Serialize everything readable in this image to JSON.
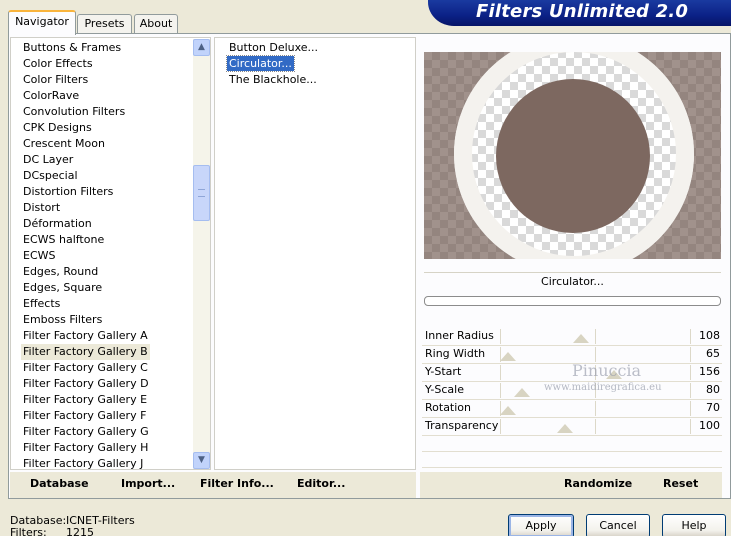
{
  "tabs": [
    {
      "label": "Navigator"
    },
    {
      "label": "Presets"
    },
    {
      "label": "About"
    }
  ],
  "banner": {
    "title": "Filters Unlimited 2.0"
  },
  "categories": [
    "Buttons & Frames",
    "Color Effects",
    "Color Filters",
    "ColorRave",
    "Convolution Filters",
    "CPK Designs",
    "Crescent Moon",
    "DC Layer",
    "DCspecial",
    "Distortion Filters",
    "Distort",
    "Déformation",
    "ECWS halftone",
    "ECWS",
    "Edges, Round",
    "Edges, Square",
    "Effects",
    "Emboss Filters",
    "Filter Factory Gallery A",
    "Filter Factory Gallery B",
    "Filter Factory Gallery C",
    "Filter Factory Gallery D",
    "Filter Factory Gallery E",
    "Filter Factory Gallery F",
    "Filter Factory Gallery G",
    "Filter Factory Gallery H",
    "Filter Factory Gallery J"
  ],
  "selected_category": "Filter Factory Gallery B",
  "filters": [
    "Button Deluxe...",
    "Circulator...",
    "The Blackhole..."
  ],
  "selected_filter": "Circulator...",
  "preview": {
    "filter_name": "Circulator...",
    "progress": 0
  },
  "sliders": [
    {
      "label": "Inner Radius",
      "value": "108",
      "level": 0.42
    },
    {
      "label": "Ring Width",
      "value": "65",
      "level": 0.0
    },
    {
      "label": "Y-Start",
      "value": "156",
      "level": 0.61
    },
    {
      "label": "Y-Scale",
      "value": "80",
      "level": 0.08
    },
    {
      "label": "Rotation",
      "value": "70",
      "level": 0.0
    },
    {
      "label": "Transparency",
      "value": "100",
      "level": 0.33
    }
  ],
  "watermark": {
    "line1": "Pinuccia",
    "line2": "www.maidiregrafica.eu"
  },
  "toolbar": {
    "database": "Database",
    "import": "Import...",
    "filter_info": "Filter Info...",
    "editor": "Editor...",
    "randomize": "Randomize",
    "reset": "Reset"
  },
  "status": {
    "database_label": "Database:",
    "database_value": "ICNET-Filters",
    "filters_label": "Filters:",
    "filters_value": "1215"
  },
  "buttons": {
    "apply": "Apply",
    "cancel": "Cancel",
    "help": "Help"
  },
  "colors": {
    "window_bg": "#ece9d8",
    "banner": "#0b2186",
    "selection": "#316ac5",
    "preview_disc": "#7d6860"
  }
}
